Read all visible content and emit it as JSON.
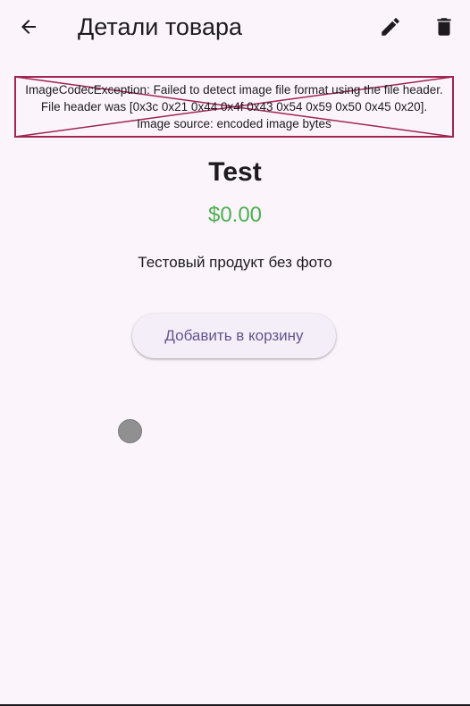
{
  "appbar": {
    "title": "Детали товара",
    "icons": {
      "back": "arrow-back-icon",
      "edit": "pencil-icon",
      "delete": "trash-icon"
    }
  },
  "image_error": {
    "lines": [
      "ImageCodecException: Failed to detect image file format using the file header.",
      "File header was [0x3c 0x21 0x44 0x4f 0x43 0x54 0x59 0x50 0x45 0x20].",
      "Image source: encoded image bytes"
    ],
    "border_color": "#a0254f"
  },
  "product": {
    "name": "Test",
    "price": "$0.00",
    "description": "Тестовый продукт без фото"
  },
  "actions": {
    "add_to_cart_label": "Добавить в корзину"
  },
  "colors": {
    "background": "#fbf5fb",
    "price": "#4caf50",
    "button_text": "#65558f",
    "button_bg": "#f3eef7"
  }
}
